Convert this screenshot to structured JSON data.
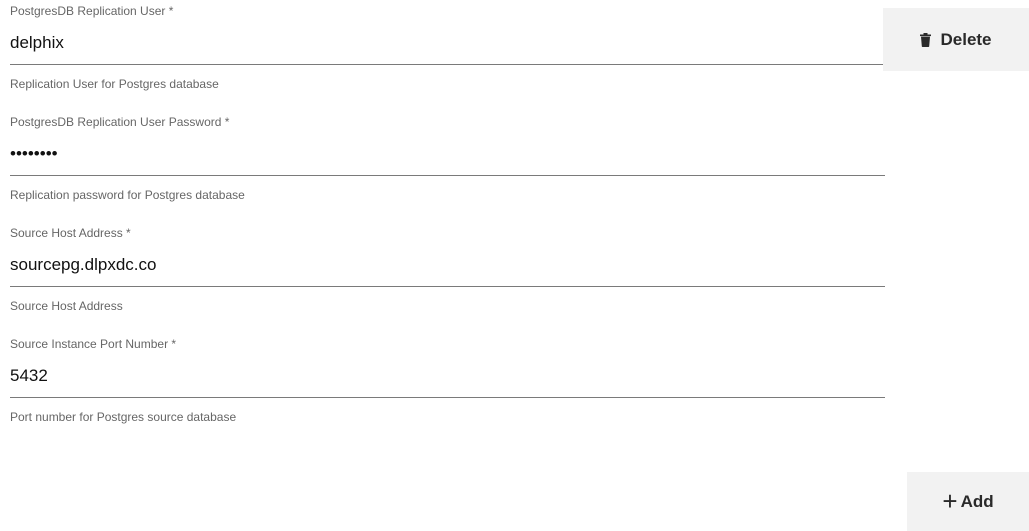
{
  "fields": [
    {
      "label": "PostgresDB Replication User *",
      "value": "delphix",
      "type": "text",
      "helper": "Replication User for Postgres database"
    },
    {
      "label": "PostgresDB Replication User Password *",
      "value": "••••••••",
      "type": "password",
      "helper": "Replication password for Postgres database"
    },
    {
      "label": "Source Host Address *",
      "value": "sourcepg.dlpxdc.co",
      "type": "text",
      "helper": "Source Host Address"
    },
    {
      "label": "Source Instance Port Number *",
      "value": "5432",
      "type": "text",
      "helper": "Port number for Postgres source database"
    }
  ],
  "buttons": {
    "delete_label": "Delete",
    "delete_icon": "trash-icon",
    "add_label": "Add",
    "add_icon": "plus-icon"
  },
  "colors": {
    "button_bg": "#f2f2f2",
    "label_text": "#666666",
    "underline": "#7a7a7a"
  }
}
